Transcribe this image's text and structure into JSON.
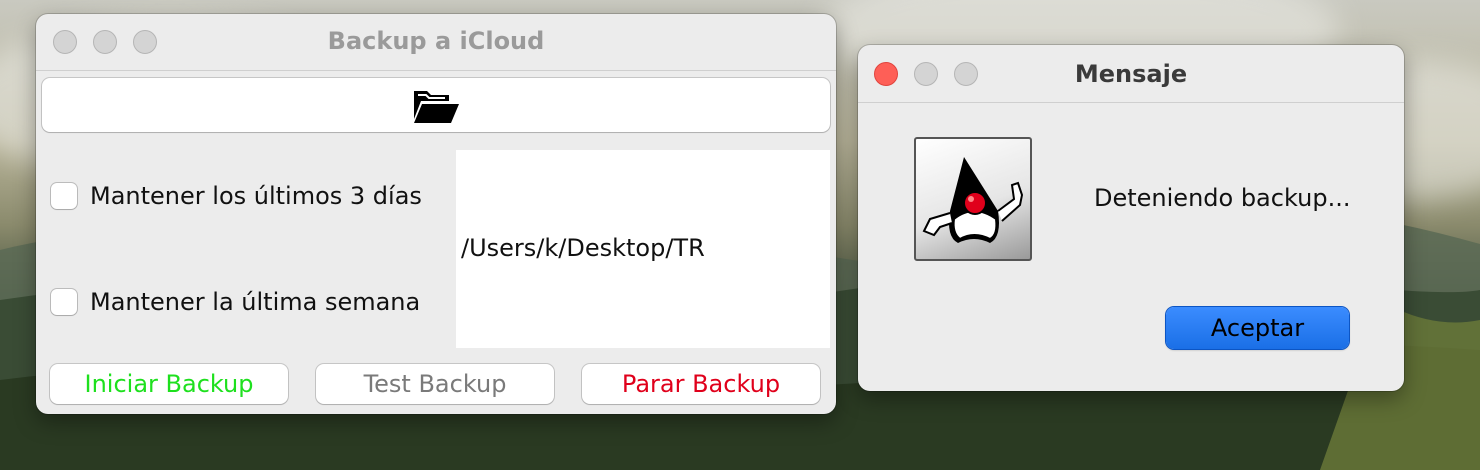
{
  "backup_window": {
    "title": "Backup a iCloud",
    "folder_button_icon": "open-folder-icon",
    "checkbox_keep_3_days": {
      "label": "Mantener los últimos 3 días",
      "checked": false
    },
    "checkbox_keep_last_week": {
      "label": "Mantener la última semana",
      "checked": false
    },
    "path_text": "/Users/k/Desktop/TR",
    "buttons": {
      "start": {
        "label": "Iniciar Backup",
        "color": "#1ee01e"
      },
      "test": {
        "label": "Test Backup",
        "color": "#7a7a7a"
      },
      "stop": {
        "label": "Parar Backup",
        "color": "#e0001b"
      }
    }
  },
  "message_dialog": {
    "title": "Mensaje",
    "icon": "java-duke-icon",
    "message": "Deteniendo backup...",
    "ok_label": "Aceptar",
    "accent_color": "#1a73f0"
  }
}
